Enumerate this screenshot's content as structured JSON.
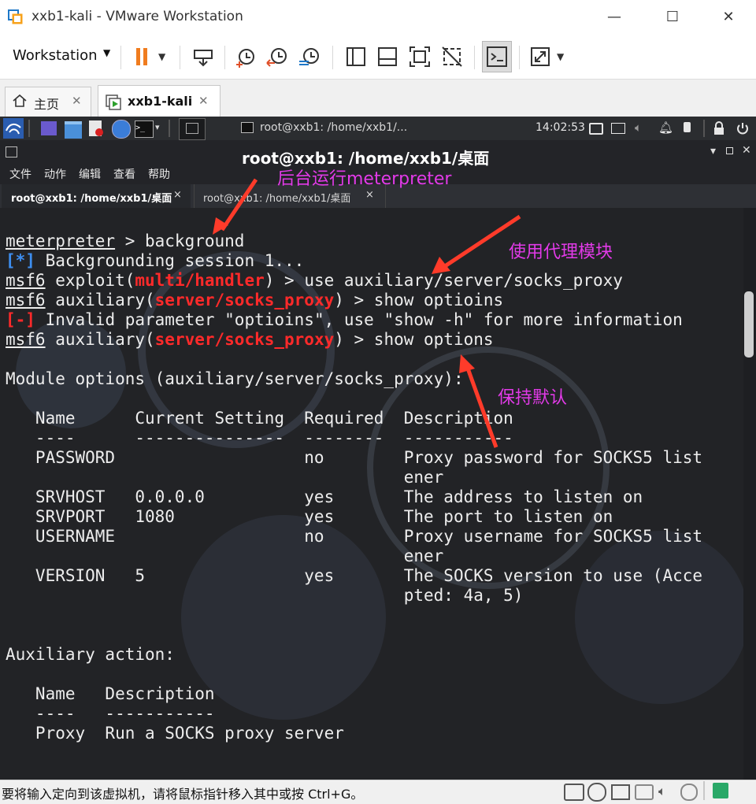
{
  "window": {
    "title": "xxb1-kali - VMware Workstation",
    "minimize": "—",
    "maximize": "☐",
    "close": "✕"
  },
  "toolbar": {
    "menu_label": "Workstation",
    "menu_caret": "▼"
  },
  "tabs": [
    {
      "label": "主页",
      "close": "✕"
    },
    {
      "label": "xxb1-kali",
      "close": "✕"
    }
  ],
  "kali_panel": {
    "task_label": "root@xxb1: /home/xxb1/...",
    "clock": "14:02:53"
  },
  "terminal": {
    "title": "root@xxb1: /home/xxb1/桌面",
    "menu": [
      "文件",
      "动作",
      "编辑",
      "查看",
      "帮助"
    ],
    "tabs": [
      {
        "label": "root@xxb1: /home/xxb1/桌面",
        "close": "×"
      },
      {
        "label": "root@xxb1: /home/xxb1/桌面",
        "close": "×"
      }
    ],
    "lines": {
      "l1_prompt": "meterpreter",
      "l1_cmd": " > background",
      "l2_tag": "[*]",
      "l2_text": " Backgrounding session 1...",
      "l3_prompt": "msf6",
      "l3_a": " exploit(",
      "l3_mod": "multi/handler",
      "l3_b": ") > use auxiliary/server/socks_proxy",
      "l4_prompt": "msf6",
      "l4_a": " auxiliary(",
      "l4_mod": "server/socks_proxy",
      "l4_b": ") > show optioins",
      "l5_tag": "[-]",
      "l5_text": " Invalid parameter \"optioins\", use \"show -h\" for more information",
      "l6_prompt": "msf6",
      "l6_a": " auxiliary(",
      "l6_mod": "server/socks_proxy",
      "l6_b": ") > show options",
      "l8": "Module options (auxiliary/server/socks_proxy):",
      "l10": "   Name      Current Setting  Required  Description",
      "l11": "   ----      ---------------  --------  -----------",
      "l12": "   PASSWORD                   no        Proxy password for SOCKS5 list",
      "l13": "                                        ener",
      "l14": "   SRVHOST   0.0.0.0          yes       The address to listen on",
      "l15": "   SRVPORT   1080             yes       The port to listen on",
      "l16": "   USERNAME                   no        Proxy username for SOCKS5 list",
      "l17": "                                        ener",
      "l18": "   VERSION   5                yes       The SOCKS version to use (Acce",
      "l19": "                                        pted: 4a, 5)",
      "l22": "Auxiliary action:",
      "l24": "   Name   Description",
      "l25": "   ----   -----------",
      "l26": "   Proxy  Run a SOCKS proxy server"
    }
  },
  "annotations": {
    "a1": "后台运行meterpreter",
    "a2": "使用代理模块",
    "a3": "保持默认",
    "color": "#e23ae8"
  },
  "statusbar": {
    "text": "要将输入定向到该虚拟机，请将鼠标指针移入其中或按 Ctrl+G。"
  },
  "colors": {
    "terminal_bg": "#222326",
    "module_red": "#ff2a2a",
    "info_blue": "#3d8ef0",
    "pause_orange": "#f07c1e"
  }
}
